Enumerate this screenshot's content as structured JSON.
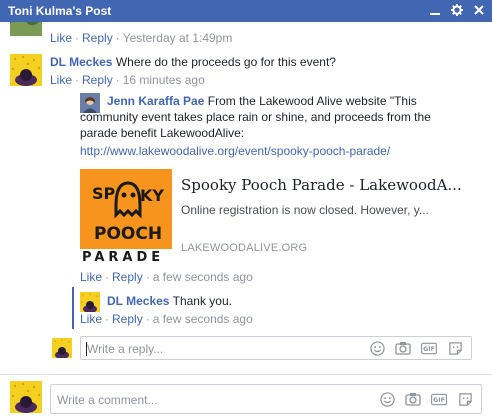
{
  "window": {
    "title": "Toni Kulma's Post"
  },
  "comments": {
    "prev": {
      "like": "Like",
      "reply": "Reply",
      "time": "Yesterday at 1:49pm"
    },
    "dl1": {
      "author": "DL Meckes",
      "text": "Where do the proceeds go for this event?",
      "like": "Like",
      "reply": "Reply",
      "time": "16 minutes ago"
    },
    "jenn": {
      "author": "Jenn Karaffa Pae",
      "text_line1": "From the Lakewood Alive website \"This",
      "text_line2": "community event takes place rain or shine, and proceeds from the",
      "text_line3": "parade benefit LakewoodAlive:",
      "url": "http://www.lakewoodalive.org/event/spooky-pooch-parade/",
      "like": "Like",
      "reply": "Reply",
      "time": "a few seconds ago"
    },
    "dl2": {
      "author": "DL Meckes",
      "text": "Thank you.",
      "like": "Like",
      "reply": "Reply",
      "time": "a few seconds ago"
    }
  },
  "link_preview": {
    "title": "Spooky Pooch Parade - LakewoodA...",
    "description": "Online registration is now closed. However, y...",
    "domain": "LAKEWOODALIVE.ORG",
    "logo_line1": "SP",
    "logo_line1b": "KY",
    "logo_line2": "POOCH",
    "logo_line3": "PARADE"
  },
  "reply_box": {
    "placeholder": "Write a reply..."
  },
  "comment_box": {
    "placeholder": "Write a comment..."
  },
  "colors": {
    "brand": "#4267b2",
    "avatar_bg": "#f5d020",
    "logo_bg": "#f7941d"
  },
  "icons": {
    "titlebar": [
      "minimize-icon",
      "gear-icon",
      "close-icon"
    ],
    "input": [
      "emoji-icon",
      "camera-icon",
      "gif-icon",
      "sticker-icon"
    ]
  }
}
